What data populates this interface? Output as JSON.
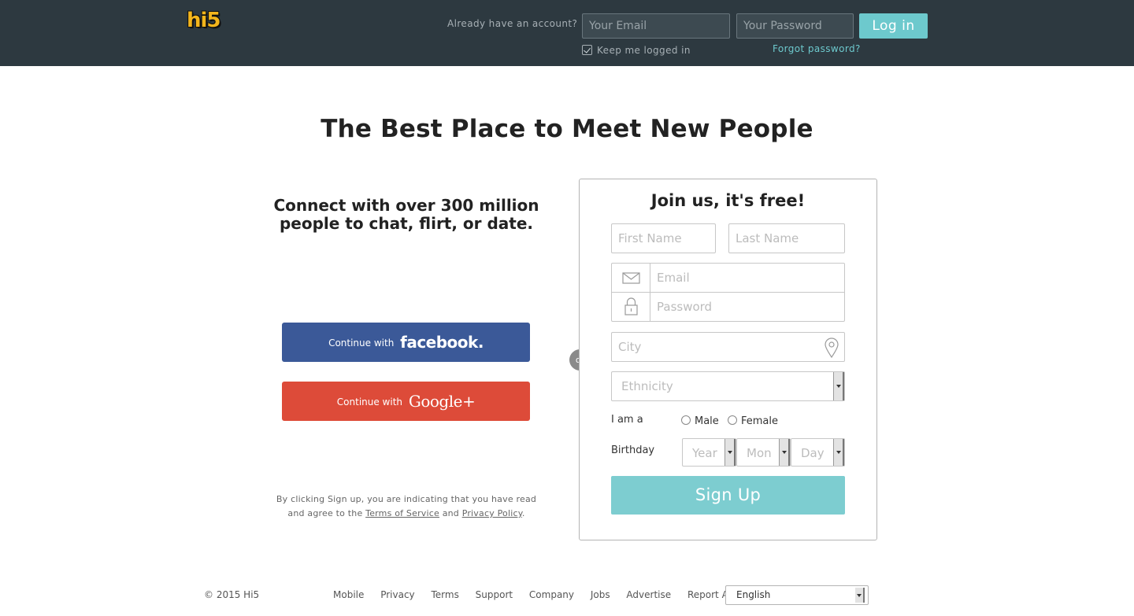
{
  "header": {
    "logo": "hi5",
    "already_text": "Already have an account?",
    "email_placeholder": "Your Email",
    "password_placeholder": "Your Password",
    "login_label": "Log in",
    "keep_logged_in": "Keep me logged in",
    "forgot_password": "Forgot password?"
  },
  "hero": {
    "headline": "The Best Place to Meet New People",
    "connect_line1": "Connect with over 300 million",
    "connect_line2": "people to chat, flirt, or date.",
    "facebook_prefix": "Continue with",
    "facebook_brand": "facebook.",
    "google_prefix": "Continue with",
    "google_brand": "Google+",
    "or_label": "or",
    "terms_part1": "By clicking Sign up, you are indicating that you have read and agree to the",
    "terms_link": "Terms of Service",
    "terms_and": "and",
    "privacy_link": "Privacy Policy",
    "terms_end": "."
  },
  "signup": {
    "title": "Join us, it's free!",
    "first_name": "First Name",
    "last_name": "Last Name",
    "email": "Email",
    "password": "Password",
    "city": "City",
    "ethnicity": "Ethnicity",
    "gender_label": "I am a",
    "male": "Male",
    "female": "Female",
    "birthday_label": "Birthday",
    "year": "Year",
    "month": "Mon",
    "day": "Day",
    "button": "Sign Up"
  },
  "footer": {
    "copyright": "© 2015 Hi5",
    "links": [
      "Mobile",
      "Privacy",
      "Terms",
      "Support",
      "Company",
      "Jobs",
      "Advertise",
      "Report Abuse"
    ],
    "language": "English"
  },
  "colors": {
    "header_bg": "#2d3940",
    "accent": "#6dc9cd",
    "facebook": "#3b5998",
    "google": "#dd4b39"
  }
}
